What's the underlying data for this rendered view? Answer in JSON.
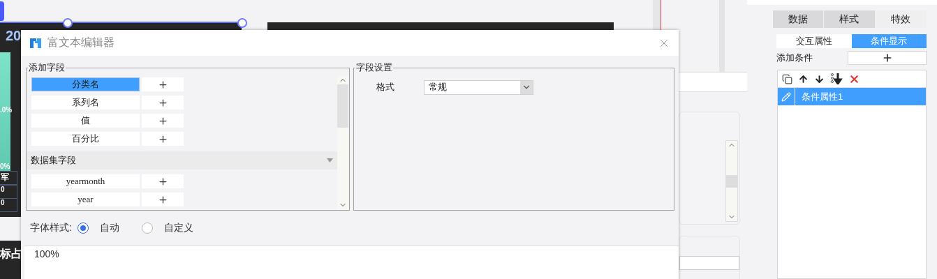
{
  "canvas": {
    "chart_title": "20",
    "axis_labels": [
      ".0%",
      "0%"
    ],
    "table_cells": [
      "军",
      "0",
      "0"
    ],
    "caption": "标占"
  },
  "dialog": {
    "title": "富文本编辑器",
    "add_fields": {
      "legend": "添加字段",
      "fields": [
        {
          "label": "分类名",
          "selected": true
        },
        {
          "label": "系列名",
          "selected": false
        },
        {
          "label": "值",
          "selected": false
        },
        {
          "label": "百分比",
          "selected": false
        }
      ],
      "group": {
        "label": "数据集字段",
        "expanded": true,
        "fields": [
          {
            "label": "yearmonth",
            "selected": false
          },
          {
            "label": "year",
            "selected": false
          }
        ]
      }
    },
    "field_settings": {
      "legend": "字段设置",
      "format_label": "格式",
      "format_value": "常规"
    },
    "font_style": {
      "label": "字体样式:",
      "options": [
        {
          "label": "自动",
          "selected": true
        },
        {
          "label": "自定义",
          "selected": false
        }
      ]
    },
    "content": "100%"
  },
  "right_panel": {
    "tabs": [
      {
        "label": "数据",
        "selected": false
      },
      {
        "label": "样式",
        "selected": false
      },
      {
        "label": "特效",
        "selected": true
      }
    ],
    "subtabs": [
      {
        "label": "交互属性",
        "selected": false
      },
      {
        "label": "条件显示",
        "selected": true
      }
    ],
    "add_condition_label": "添加条件",
    "conditions": [
      {
        "label": "条件属性1",
        "selected": true
      }
    ]
  }
}
